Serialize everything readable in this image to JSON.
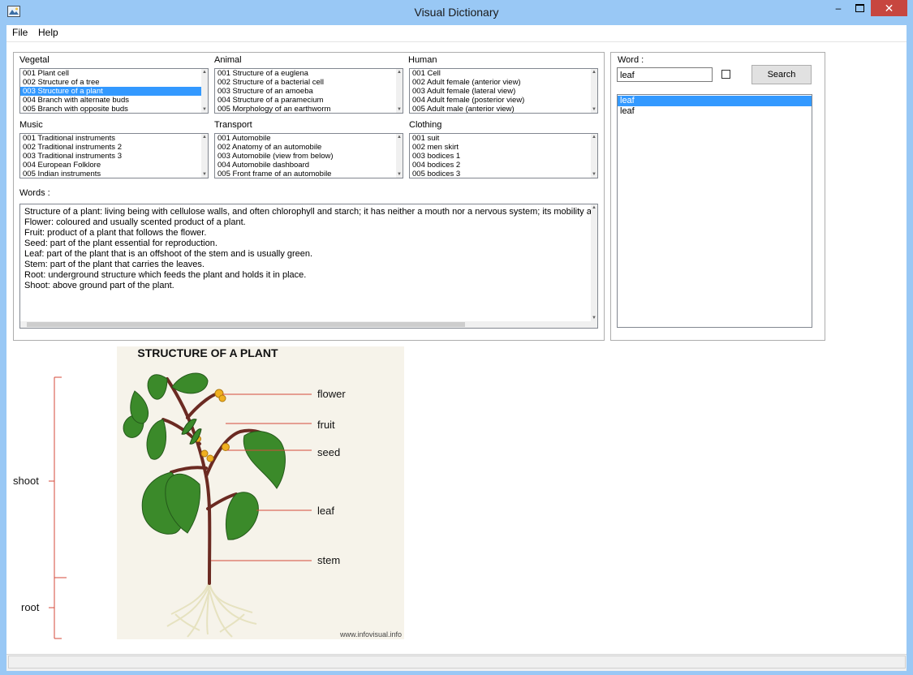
{
  "window": {
    "title": "Visual Dictionary"
  },
  "menu": {
    "file": "File",
    "help": "Help"
  },
  "categories": {
    "vegetal": {
      "label": "Vegetal",
      "items": [
        "001 Plant cell",
        "002 Structure of a tree",
        "003 Structure of a plant",
        "004 Branch with alternate buds",
        "005 Branch with opposite buds"
      ]
    },
    "animal": {
      "label": "Animal",
      "items": [
        "001 Structure of a euglena",
        "002 Structure of a bacterial cell",
        "003 Structure of an amoeba",
        "004 Structure of a paramecium",
        "005 Morphology of an earthworm"
      ]
    },
    "human": {
      "label": "Human",
      "items": [
        "001 Cell",
        "002 Adult female (anterior view)",
        "003 Adult female (lateral view)",
        "004 Adult female (posterior view)",
        "005 Adult male (anterior view)"
      ]
    },
    "music": {
      "label": "Music",
      "items": [
        "001 Traditional instruments",
        "002 Traditional instruments 2",
        "003 Traditional instruments 3",
        "004 European Folklore",
        "005 Indian instruments"
      ]
    },
    "transport": {
      "label": "Transport",
      "items": [
        "001 Automobile",
        "002 Anatomy of an automobile",
        "003 Automobile (view from below)",
        "004 Automobile dashboard",
        "005 Front frame of an automobile"
      ]
    },
    "clothing": {
      "label": "Clothing",
      "items": [
        "001 suit",
        "002 men skirt",
        "003 bodices 1",
        "004 bodices 2",
        "005 bodices 3"
      ]
    }
  },
  "words": {
    "label": "Words :",
    "lines": [
      "Structure of a plant: living being with cellulose walls, and often chlorophyll and starch; it has neither a mouth nor a nervous system; its mobility a",
      "Flower: coloured and usually scented product of a plant.",
      "Fruit: product of a plant that follows the flower.",
      "Seed: part of the plant essential for reproduction.",
      "Leaf: part of the plant that is an offshoot of the stem and is usually green.",
      "Stem: part of the plant that carries the leaves.",
      "Root: underground structure which feeds the plant and holds it in place.",
      "Shoot: above ground part of the plant."
    ]
  },
  "search": {
    "label": "Word :",
    "value": "leaf",
    "button": "Search",
    "results": [
      "leaf",
      "leaf"
    ]
  },
  "illustration": {
    "title": "STRUCTURE OF A PLANT",
    "labels": {
      "flower": "flower",
      "fruit": "fruit",
      "seed": "seed",
      "leaf": "leaf",
      "stem": "stem",
      "shoot": "shoot",
      "root": "root"
    },
    "credit": "www.infovisual.info",
    "colors": {
      "leaf": "#3b8a2a",
      "stem": "#6b2a22",
      "flower": "#f0b020",
      "label_line": "#d44a3a"
    }
  }
}
